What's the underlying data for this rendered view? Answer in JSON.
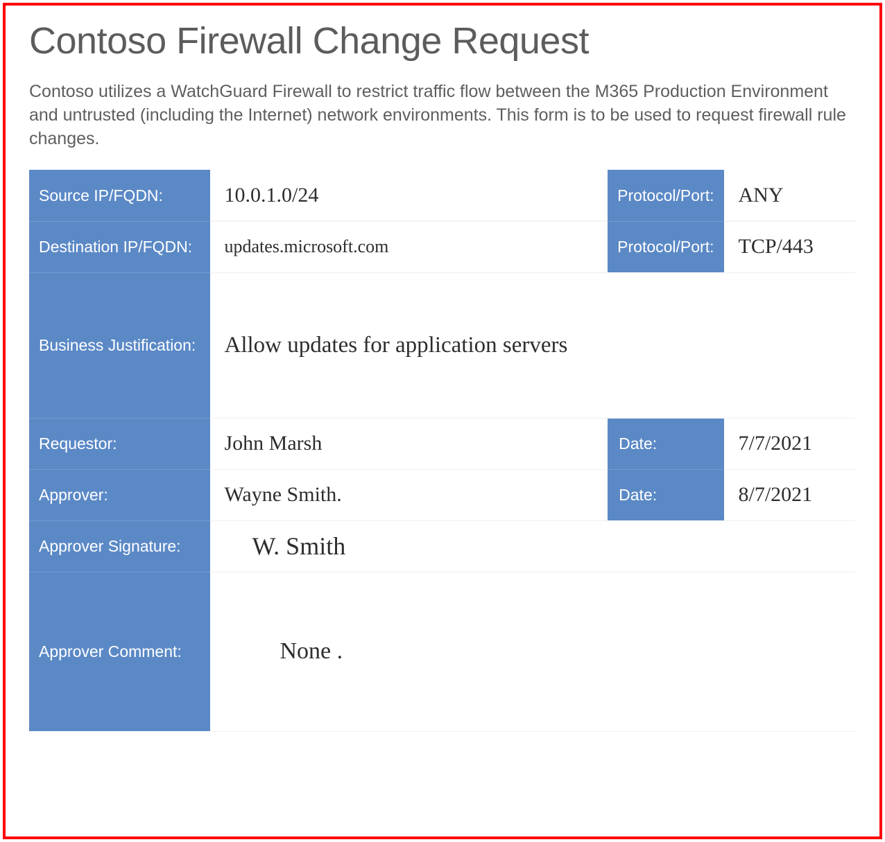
{
  "title": "Contoso Firewall Change Request",
  "description": "Contoso utilizes a WatchGuard Firewall to restrict traffic flow between the M365 Production Environment and untrusted (including the Internet) network environments.  This form is to be used to request firewall rule changes.",
  "form": {
    "source_ip_label": "Source IP/FQDN:",
    "source_ip_value": "10.0.1.0/24",
    "source_port_label": "Protocol/Port:",
    "source_port_value": "ANY",
    "dest_ip_label": "Destination IP/FQDN:",
    "dest_ip_value": "updates.microsoft.com",
    "dest_port_label": "Protocol/Port:",
    "dest_port_value": "TCP/443",
    "justification_label": "Business Justification:",
    "justification_value": "Allow updates for application servers",
    "requestor_label": "Requestor:",
    "requestor_value": "John Marsh",
    "requestor_date_label": "Date:",
    "requestor_date_value": "7/7/2021",
    "approver_label": "Approver:",
    "approver_value": "Wayne Smith.",
    "approver_date_label": "Date:",
    "approver_date_value": "8/7/2021",
    "approver_sig_label": "Approver Signature:",
    "approver_sig_value": "W. Smith",
    "approver_comment_label": "Approver Comment:",
    "approver_comment_value": "None ."
  }
}
